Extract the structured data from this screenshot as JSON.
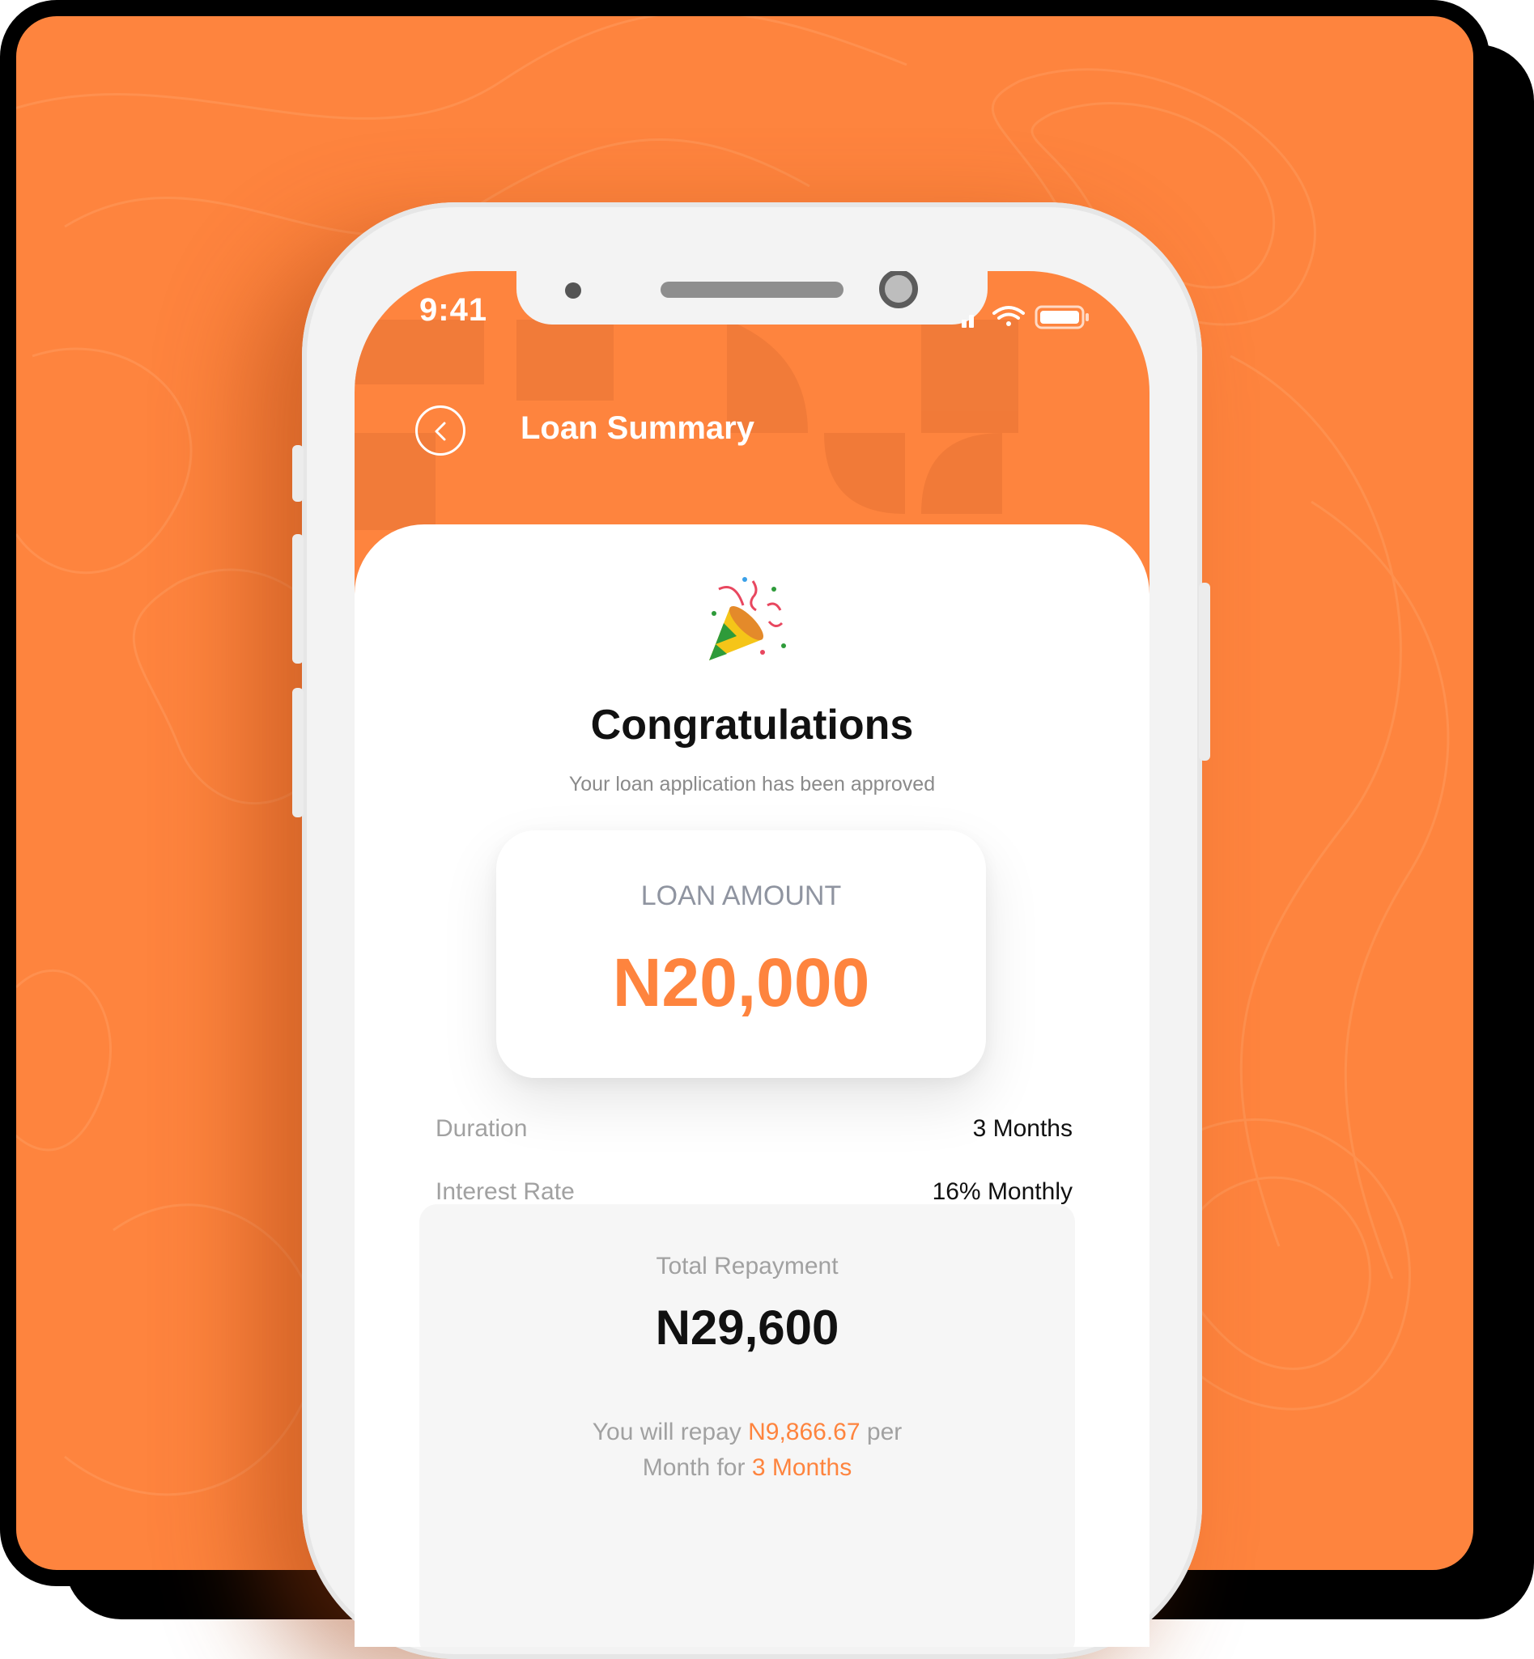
{
  "colors": {
    "brand_orange": "#fe843e",
    "text_dark": "#111111",
    "text_muted": "#a1a1a1",
    "card_border": "#000000"
  },
  "status_bar": {
    "time": "9:41",
    "icons": [
      "signal-icon",
      "wifi-icon",
      "battery-icon"
    ]
  },
  "header": {
    "back_icon": "chevron-left-icon",
    "title": "Loan Summary"
  },
  "hero": {
    "icon": "party-popper-icon",
    "title": "Congratulations",
    "subtitle": "Your loan application has been approved"
  },
  "loan_amount": {
    "label": "LOAN AMOUNT",
    "value": "N20,000"
  },
  "details": [
    {
      "label": "Duration",
      "value": "3 Months"
    },
    {
      "label": "Interest Rate",
      "value": "16% Monthly"
    }
  ],
  "repayment": {
    "title": "Total Repayment",
    "value": "N29,600",
    "note_prefix": "You will repay",
    "note_amount": "N9,866.67",
    "note_mid": "per",
    "note_line2_prefix": "Month for",
    "note_duration": "3 Months"
  }
}
